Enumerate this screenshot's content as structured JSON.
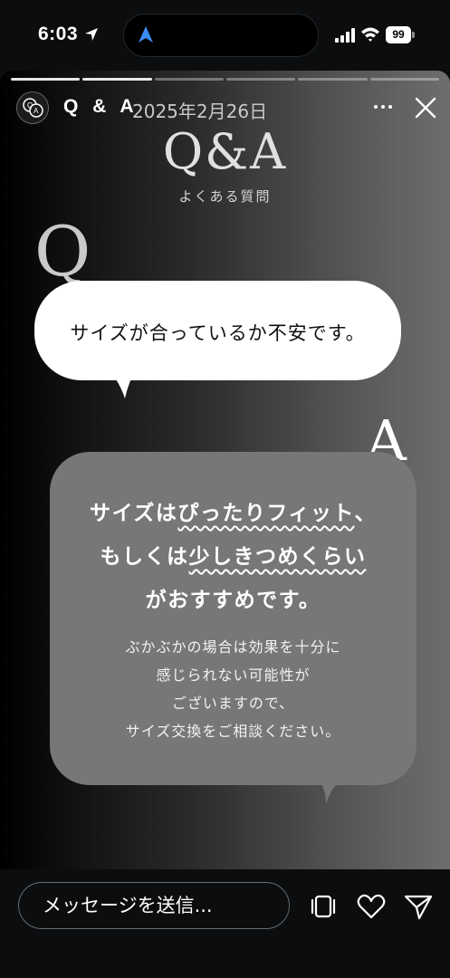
{
  "status_bar": {
    "time": "6:03",
    "battery": "99"
  },
  "story": {
    "name": "Q & A",
    "date": "2025年2月26日",
    "progress_total": 6,
    "progress_done": 2
  },
  "content": {
    "title": "Q&A",
    "subtitle": "よくある質問",
    "q_letter": "Q",
    "question": "サイズが合っているか不安です。",
    "a_letter": "A",
    "answer_headline_1_pre": "サイズは",
    "answer_headline_1_wavy": "ぴったりフィット",
    "answer_headline_1_post": "、",
    "answer_headline_2_pre": "もしくは",
    "answer_headline_2_wavy": "少しきつめくらい",
    "answer_headline_3": "がおすすめです。",
    "answer_body": [
      "ぶかぶかの場合は効果を十分に",
      "感じられない可能性が",
      "ございますので、",
      "サイズ交換をご相談ください。"
    ]
  },
  "bottom": {
    "message_placeholder": "メッセージを送信..."
  }
}
